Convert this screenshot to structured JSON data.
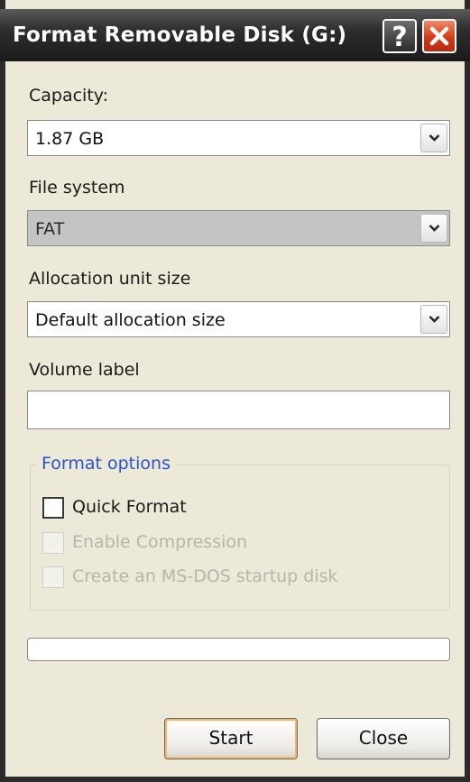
{
  "window": {
    "title": "Format Removable Disk (G:)",
    "help_glyph": "?",
    "help_icon": "question-mark-icon",
    "close_icon": "close-x-icon",
    "close_color": "#d33b1a"
  },
  "capacity": {
    "label": "Capacity:",
    "value": "1.87 GB"
  },
  "file_system": {
    "label": "File system",
    "value": "FAT",
    "disabled": true
  },
  "allocation": {
    "label": "Allocation unit size",
    "value": "Default allocation size"
  },
  "volume_label": {
    "label": "Volume label",
    "value": ""
  },
  "format_options": {
    "title": "Format options",
    "quick_format": {
      "label": "Quick Format",
      "checked": false,
      "enabled": true
    },
    "enable_compression": {
      "label": "Enable Compression",
      "checked": false,
      "enabled": false
    },
    "ms_dos_startup": {
      "label": "Create an MS-DOS startup disk",
      "checked": false,
      "enabled": false
    }
  },
  "progress": {
    "value": 0
  },
  "buttons": {
    "start": "Start",
    "close": "Close"
  },
  "colors": {
    "dialog_bg": "#ece9d8",
    "titlebar": "#1a1a1a",
    "group_title": "#2a54c8",
    "default_button_glow": "#f0b66a"
  }
}
